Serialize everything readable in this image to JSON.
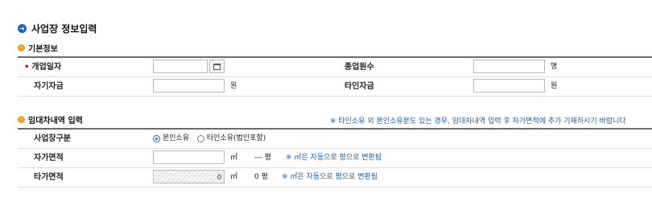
{
  "page": {
    "title": "사업장 정보입력"
  },
  "basic_info": {
    "heading": "기본정보",
    "required_mark": "•",
    "open_date_label": "개업일자",
    "open_date_value": "",
    "employees_label": "종업원수",
    "employees_value": "",
    "employees_unit": "명",
    "own_capital_label": "자기자금",
    "own_capital_value": "",
    "own_capital_unit": "원",
    "other_capital_label": "타인자금",
    "other_capital_value": "",
    "other_capital_unit": "원"
  },
  "lease_info": {
    "heading": "임대차내역 입력",
    "notice": "※ 타인소유 외 본인소유분도 있는 경우, 임대차내역 입력 후 자가면적에 추가 기재하시기 바랍니다",
    "type_label": "사업장구분",
    "type_options": [
      "본인소유",
      "타인소유(법인포함)"
    ],
    "type_selected": "본인소유",
    "own_area_label": "자가면적",
    "own_area_value": "",
    "own_area_unit": "㎡",
    "own_area_pyeong": "--- 평",
    "own_area_note": "※ ㎡은 자동으로 평으로 변환됨",
    "other_area_label": "타가면적",
    "other_area_value": "0",
    "other_area_unit": "㎡",
    "other_area_pyeong": "0 평",
    "other_area_note": "※ ㎡은 자동으로 평으로 변환됨"
  }
}
